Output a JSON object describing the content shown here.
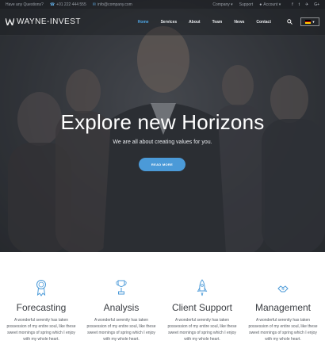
{
  "topbar": {
    "questions_label": "Have any Questions?",
    "phone": "+01 222 444 555",
    "email": "info@company.com",
    "company_label": "Company ▾",
    "support_label": "Support",
    "account_label": "Account ▾",
    "social": [
      "facebook-icon",
      "twitter-icon",
      "tripadvisor-icon",
      "google-plus-icon"
    ]
  },
  "header": {
    "logo_text": "WAYNE-INVEST",
    "nav": [
      "Home",
      "Services",
      "About",
      "Team",
      "News",
      "Contact"
    ],
    "active_nav": "Home",
    "language": "de"
  },
  "hero": {
    "title": "Explore new Horizons",
    "subtitle": "We are all about creating values for you.",
    "button": "READ MORE"
  },
  "services": [
    {
      "icon": "award-icon",
      "title": "Forecasting",
      "desc": "A wonderful serenity has taken possession of my entire soul, like these sweet mornings of spring which I enjoy with my whole heart."
    },
    {
      "icon": "trophy-icon",
      "title": "Analysis",
      "desc": "A wonderful serenity has taken possession of my entire soul, like these sweet mornings of spring which I enjoy with my whole heart."
    },
    {
      "icon": "rocket-icon",
      "title": "Client Support",
      "desc": "A wonderful serenity has taken possession of my entire soul, like these sweet mornings of spring which I enjoy with my whole heart."
    },
    {
      "icon": "handshake-icon",
      "title": "Management",
      "desc": "A wonderful serenity has taken possession of my entire soul, like these sweet mornings of spring which I enjoy with my whole heart."
    }
  ],
  "colors": {
    "accent": "#4b9ad8",
    "active_nav": "#4fa8e8"
  }
}
